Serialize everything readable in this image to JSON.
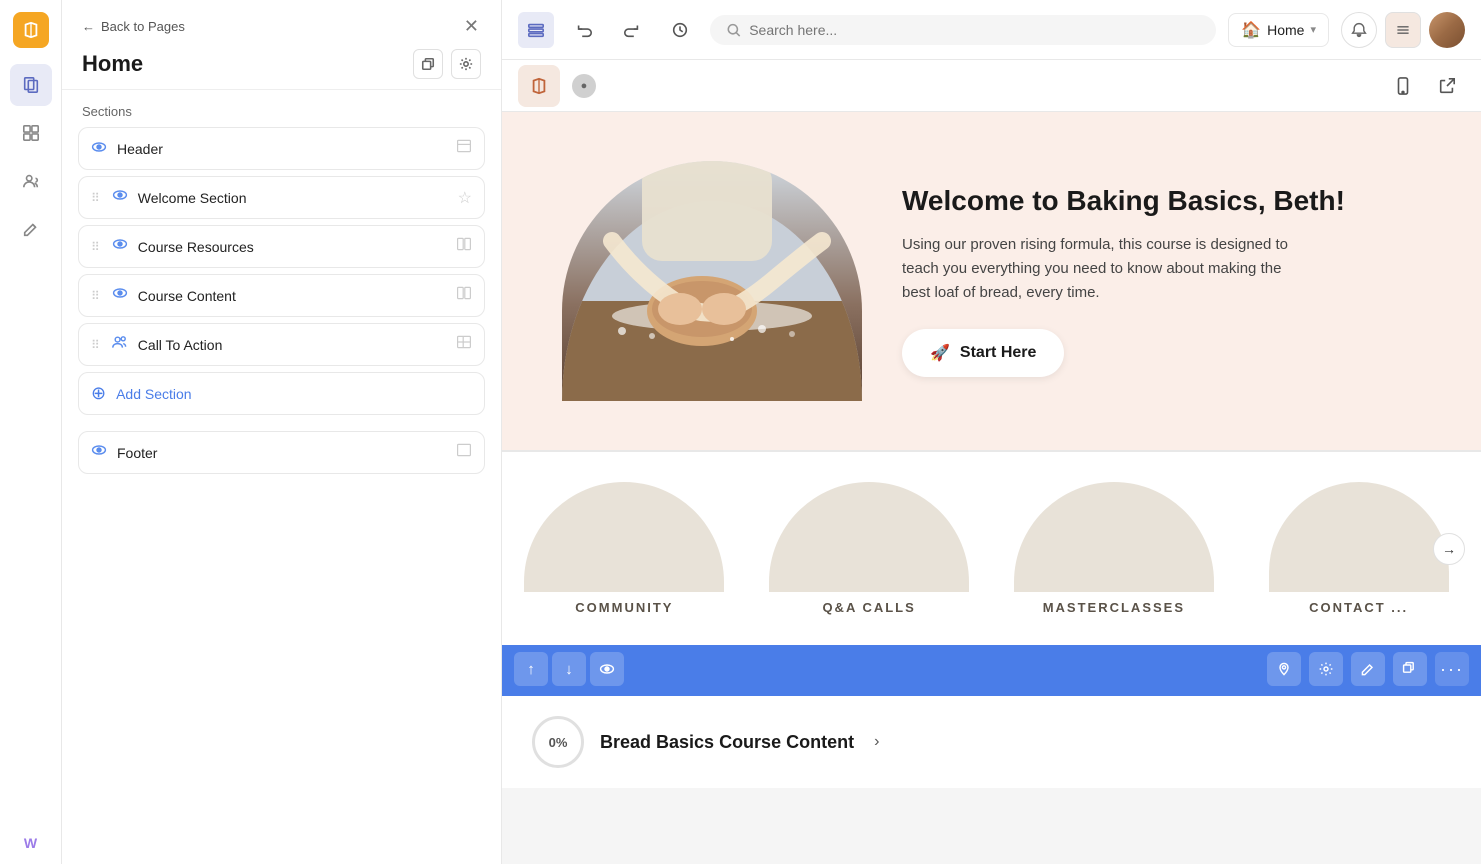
{
  "app": {
    "logo": "✕",
    "back_label": "Back to Pages",
    "close_label": "✕"
  },
  "page_panel": {
    "title": "Home",
    "sections_label": "Sections",
    "sections": [
      {
        "id": "header",
        "name": "Header",
        "icon": "👁",
        "action": "🗂"
      },
      {
        "id": "welcome",
        "name": "Welcome Section",
        "icon": "👁",
        "action": "☆",
        "drag": true
      },
      {
        "id": "resources",
        "name": "Course Resources",
        "icon": "👁",
        "action": "⊞",
        "drag": true
      },
      {
        "id": "content",
        "name": "Course Content",
        "icon": "👁",
        "action": "⊞",
        "drag": true
      },
      {
        "id": "cta",
        "name": "Call To Action",
        "icon": "👁",
        "action": "⊞",
        "drag": true
      }
    ],
    "add_section_label": "Add Section",
    "footer_section": {
      "name": "Footer",
      "icon": "👁",
      "action": "▭"
    }
  },
  "toolbar": {
    "page_name": "Home",
    "undo_label": "undo",
    "redo_label": "redo",
    "history_label": "history",
    "search_placeholder": "Search here...",
    "mobile_icon": "📱",
    "open_icon": "↗"
  },
  "welcome_section": {
    "title": "Welcome to Baking Basics, Beth!",
    "description": "Using our proven rising formula, this course is designed to teach you everything you need to know about making the best loaf of bread, every time.",
    "cta_button": "Start Here",
    "cta_icon": "🚀"
  },
  "cards": [
    {
      "id": "community",
      "label": "COMMUNITY"
    },
    {
      "id": "qa",
      "label": "Q&A CALLS"
    },
    {
      "id": "masterclasses",
      "label": "MASTERCLASSES"
    },
    {
      "id": "contact",
      "label": "CONTACT ..."
    }
  ],
  "course_content": {
    "progress": "0%",
    "title": "Bread Basics Course Content",
    "arrow": "›"
  },
  "bottom_bar": {
    "up": "↑",
    "down": "↓",
    "eye": "👁",
    "icons_right": [
      "🏠",
      "⚙",
      "✏",
      "⧉",
      "···"
    ]
  }
}
